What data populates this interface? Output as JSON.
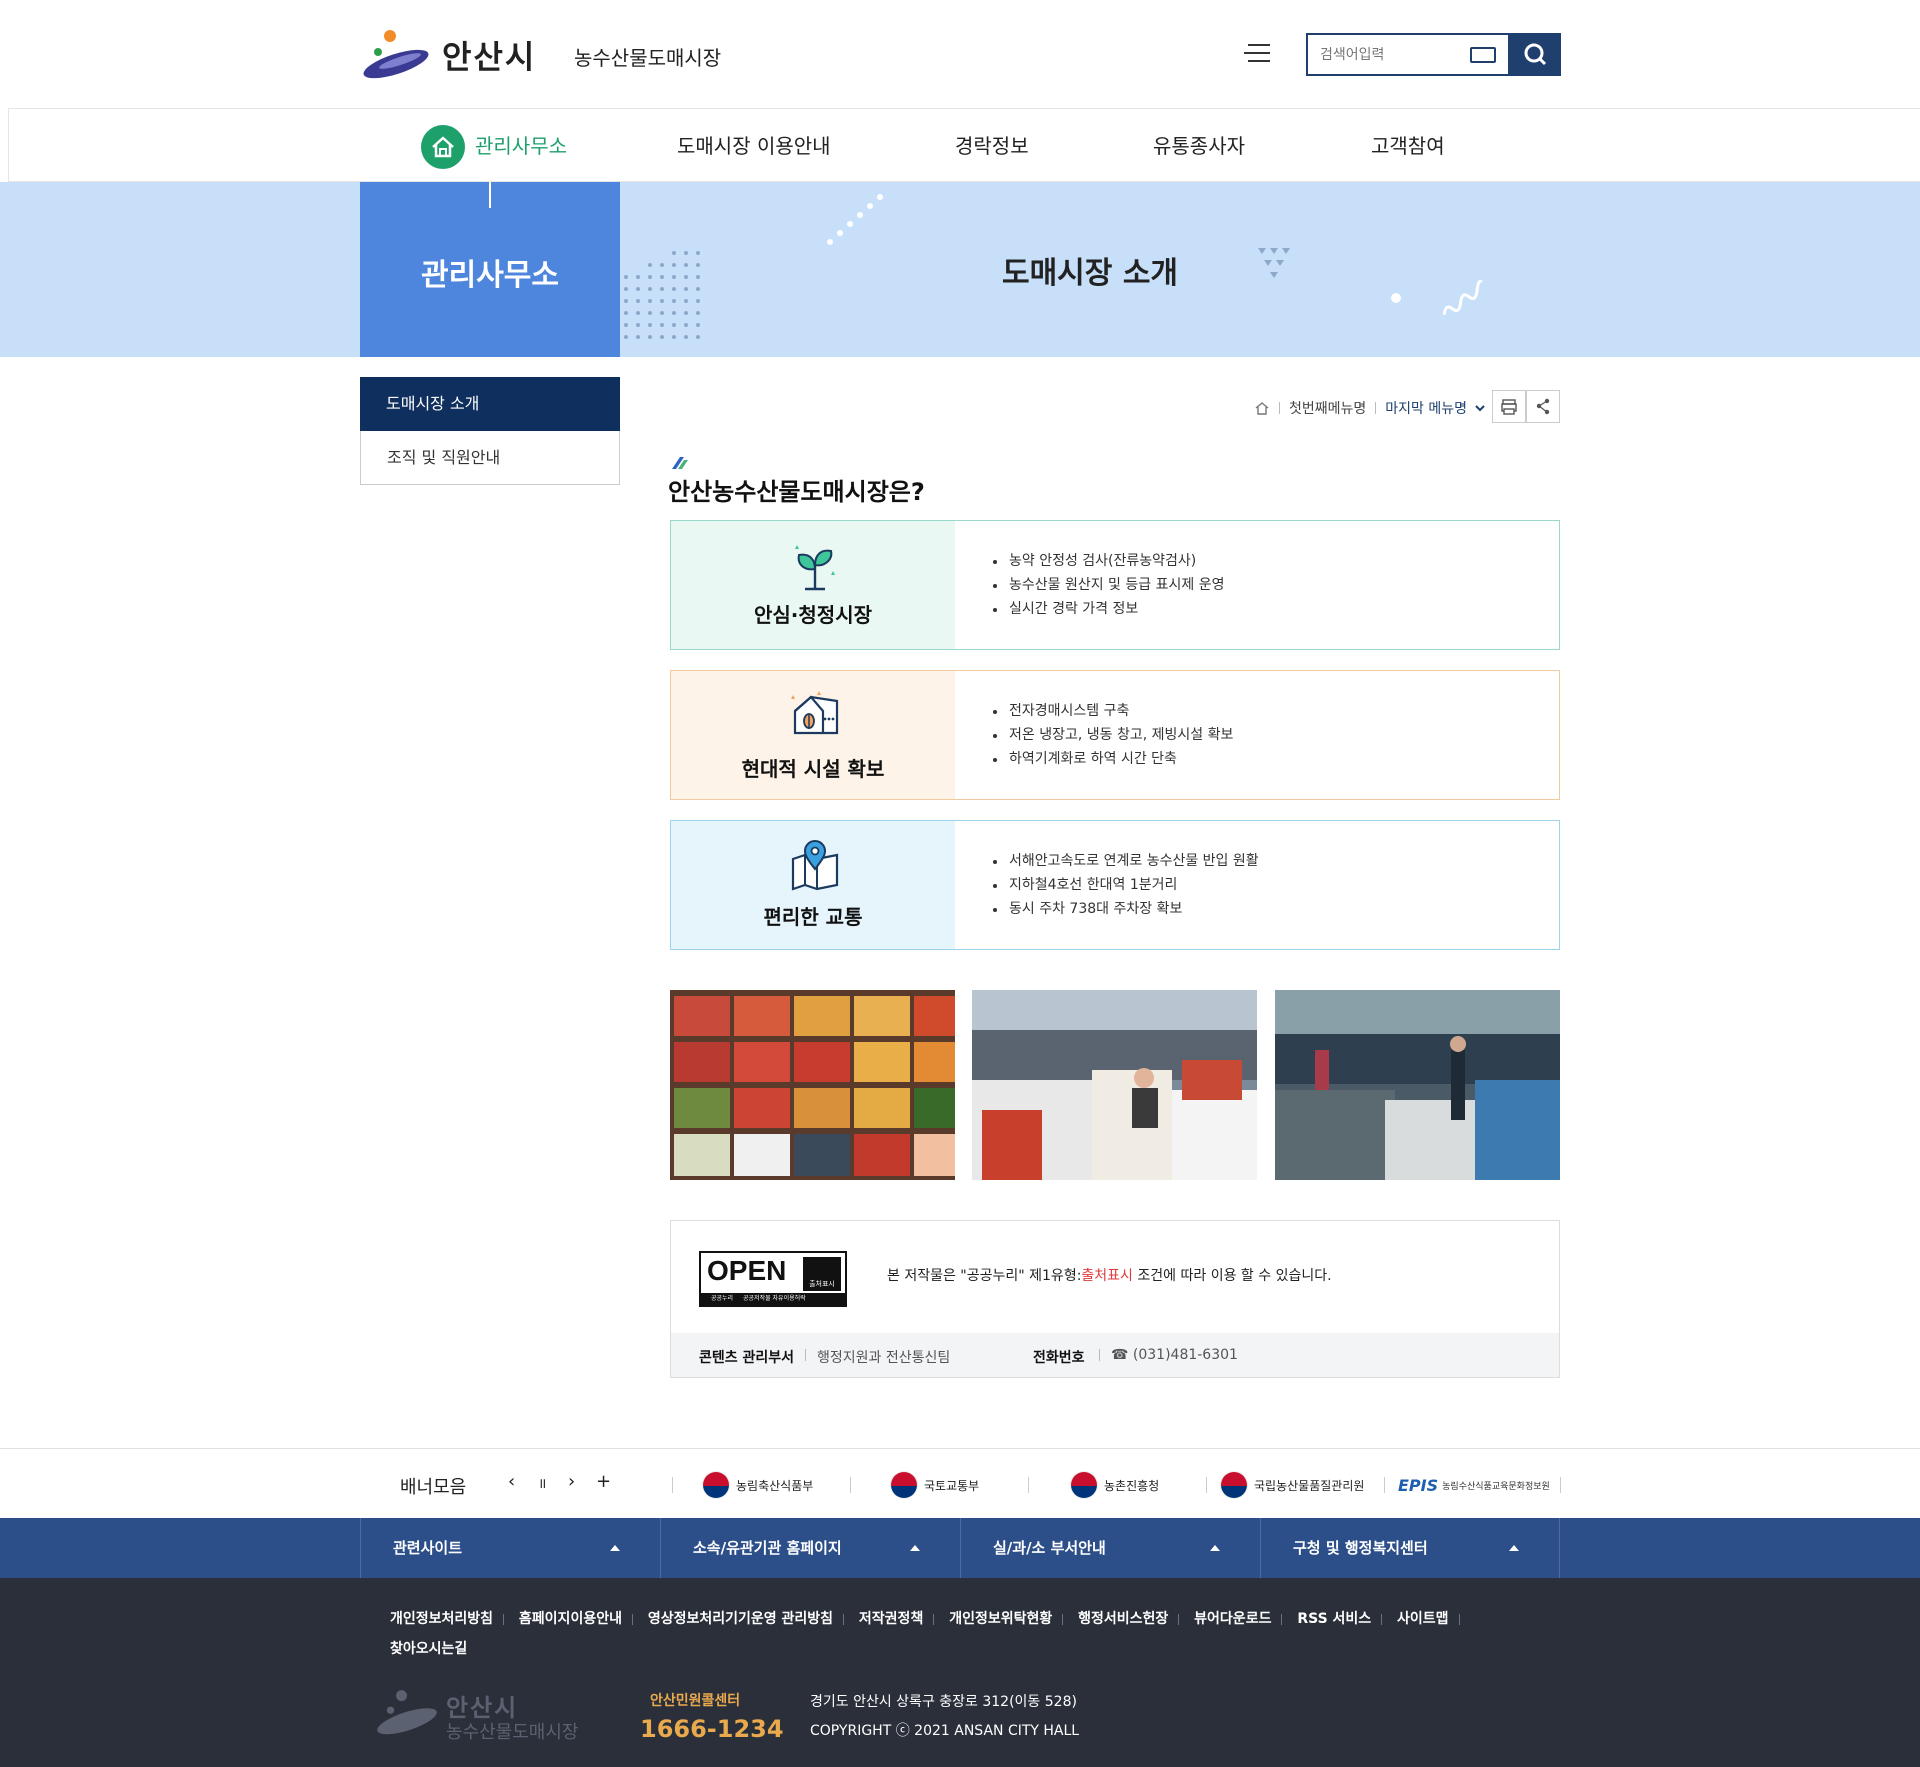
{
  "header": {
    "logo_city": "안산시",
    "logo_sub": "농수산물도매시장",
    "search_placeholder": "검색어입력"
  },
  "gnb": [
    {
      "label": "관리사무소",
      "active": true
    },
    {
      "label": "도매시장 이용안내"
    },
    {
      "label": "경락정보"
    },
    {
      "label": "유통종사자"
    },
    {
      "label": "고객참여"
    }
  ],
  "visual": {
    "side_title": "관리사무소",
    "page_title": "도매시장 소개"
  },
  "lnb": [
    {
      "label": "도매시장 소개",
      "active": true
    },
    {
      "label": "조직 및 직원안내"
    }
  ],
  "breadcrumb": {
    "first": "첫번째메뉴명",
    "last": "마지막 메뉴명"
  },
  "section_title": "안산농수산물도매시장은?",
  "features": [
    {
      "title": "안심·청정시장",
      "icon": "sprout-icon",
      "items": [
        "농약 안정성 검사(잔류농약검사)",
        "농수산물 원산지 및 등급 표시제 운영",
        "실시간 경락 가격 정보"
      ]
    },
    {
      "title": "현대적 시설 확보",
      "icon": "building-icon",
      "items": [
        "전자경매시스템 구축",
        "저온 냉장고, 냉동 창고, 제빙시설 확보",
        "하역기계화로 하역 시간 단축"
      ]
    },
    {
      "title": "편리한 교통",
      "icon": "map-pin-icon",
      "items": [
        "서해안고속도로 연계로 농수산물 반입 원활",
        "지하철4호선 한대역 1분거리",
        "동시 주차 738대 주차장 확보"
      ]
    }
  ],
  "license": {
    "kogl_open": "OPEN",
    "kogl_badge": "출처표시",
    "kogl_caption1": "공공누리",
    "kogl_caption2": "공공저작물 자유이용허락",
    "text_before": "본 저작물은 \"공공누리\" 제1유형:",
    "text_highlight": "출처표시",
    "text_after": " 조건에 따라 이용 할 수 있습니다.",
    "dept_label": "콘텐츠 관리부서",
    "dept_value": "행정지원과 전산통신팀",
    "phone_label": "전화번호",
    "phone_value": "☎ (031)481-6301"
  },
  "banner": {
    "label": "배너모음",
    "prev": "‹",
    "pause": "॥",
    "next": "›",
    "more": "+",
    "logos": [
      "농림축산식품부",
      "국토교통부",
      "농촌진흥청",
      "국립농산물품질관리원"
    ],
    "epis_logo": "EPIS",
    "epis_text": "농림수산식품교육문화정보원"
  },
  "footer_sites": [
    "관련사이트",
    "소속/유관기관 홈페이지",
    "실/과/소 부서안내",
    "구청 및 행정복지센터"
  ],
  "footer_links": [
    "개인정보처리방침",
    "홈페이지이용안내",
    "영상정보처리기기운영 관리방침",
    "저작권정책",
    "개인정보위탁현황",
    "행정서비스헌장",
    "뷰어다운로드",
    "RSS 서비스",
    "사이트맵",
    "찾아오시는길"
  ],
  "footer": {
    "logo_city": "안산시",
    "logo_sub": "농수산물도매시장",
    "call_label": "안산민원콜센터",
    "call_num": "1666-1234",
    "address": "경기도 안산시 상록구 충장로 312(이동 528)",
    "copyright": "COPYRIGHT ⓒ 2021 ANSAN CITY HALL"
  }
}
